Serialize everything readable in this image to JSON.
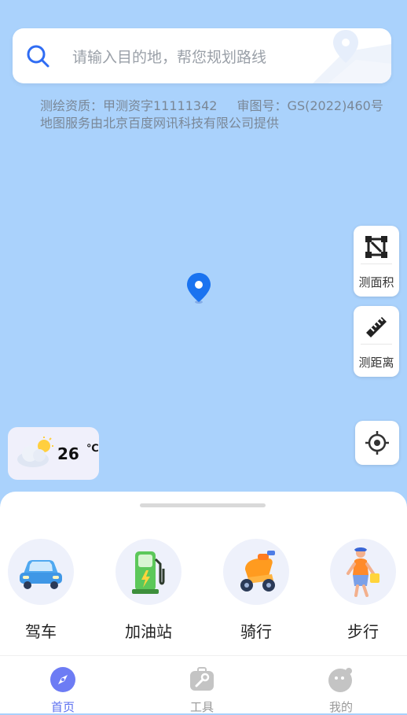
{
  "search": {
    "placeholder": "请输入目的地，帮您规划路线"
  },
  "map": {
    "copyright_line1_a": "测绘资质：甲测资字11111342",
    "copyright_line1_b": "审图号：GS(2022)460号",
    "copyright_line2": "地图服务由北京百度网讯科技有限公司提供"
  },
  "tools": {
    "measure_area": "测面积",
    "measure_distance": "测距离"
  },
  "weather": {
    "temperature": "26",
    "unit": "℃",
    "icon": "partly-cloudy-icon"
  },
  "modes": [
    {
      "label": "驾车",
      "icon": "car-icon"
    },
    {
      "label": "加油站",
      "icon": "gas-station-icon"
    },
    {
      "label": "骑行",
      "icon": "scooter-icon"
    },
    {
      "label": "步行",
      "icon": "walking-person-icon"
    }
  ],
  "tabs": [
    {
      "label": "首页",
      "icon": "compass-icon",
      "active": true
    },
    {
      "label": "工具",
      "icon": "toolbox-icon",
      "active": false
    },
    {
      "label": "我的",
      "icon": "profile-face-icon",
      "active": false
    }
  ],
  "colors": {
    "accent": "#5b6ff0",
    "map_background": "#aad2fc",
    "pin": "#1a73f0"
  }
}
